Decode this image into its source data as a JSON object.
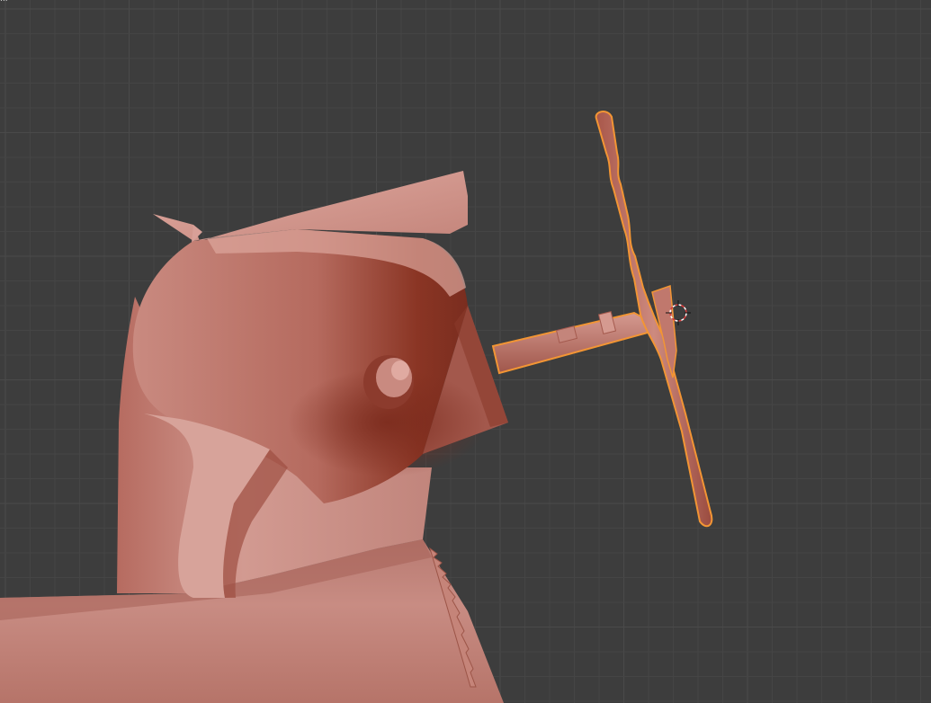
{
  "viewport": {
    "background": "#3d3d3d",
    "grid_minor": "#454545",
    "grid_major": "#4a4a4a",
    "corner_text": "..."
  },
  "scene": {
    "model_color": "#c47f76",
    "model_shadow": "#7a2f22",
    "model_dark": "#9a4a3d",
    "selection_outline": "#f29534",
    "objects": [
      {
        "name": "seat-body",
        "selected": false
      },
      {
        "name": "steering-column",
        "selected": true
      },
      {
        "name": "steering-wheel",
        "selected": true
      }
    ],
    "cursor": "3d-cursor-icon"
  }
}
